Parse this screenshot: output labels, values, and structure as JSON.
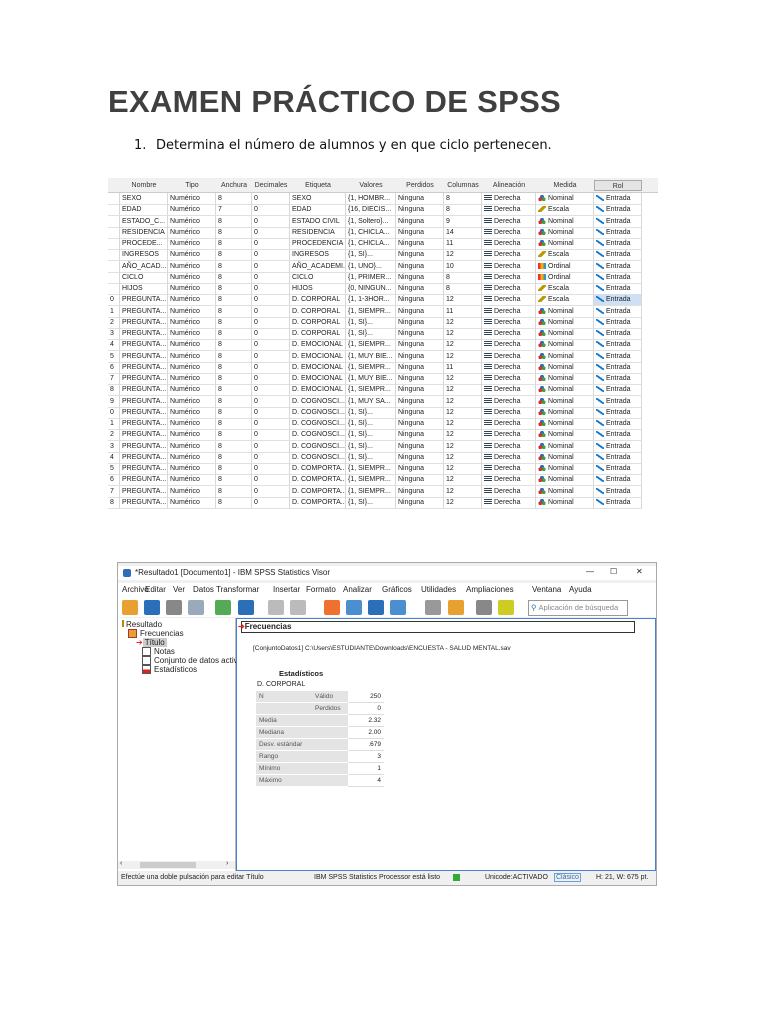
{
  "title": "EXAMEN PRÁCTICO DE SPSS",
  "question": {
    "number": "1.",
    "text": "Determina el número de alumnos y en que ciclo pertenecen."
  },
  "variable_view": {
    "headers": [
      "Nombre",
      "Tipo",
      "Anchura",
      "Decimales",
      "Etiqueta",
      "Valores",
      "Perdidos",
      "Columnas",
      "Alineación",
      "Medida",
      "Rol"
    ],
    "rows": [
      [
        "",
        "SEXO",
        "Numérico",
        "8",
        "0",
        "SEXO",
        "{1, HOMBR...",
        "Ninguna",
        "8",
        "Derecha",
        "Nominal",
        "Entrada"
      ],
      [
        "",
        "EDAD",
        "Numérico",
        "7",
        "0",
        "EDAD",
        "{16, DIECIS...",
        "Ninguna",
        "8",
        "Derecha",
        "Escala",
        "Entrada"
      ],
      [
        "",
        "ESTADO_C...",
        "Numérico",
        "8",
        "0",
        "ESTADO CIVIL",
        "{1, Soltero}...",
        "Ninguna",
        "9",
        "Derecha",
        "Nominal",
        "Entrada"
      ],
      [
        "",
        "RESIDENCIA",
        "Numérico",
        "8",
        "0",
        "RESIDENCIA",
        "{1, CHICLA...",
        "Ninguna",
        "14",
        "Derecha",
        "Nominal",
        "Entrada"
      ],
      [
        "",
        "PROCEDE...",
        "Numérico",
        "8",
        "0",
        "PROCEDENCIA",
        "{1, CHICLA...",
        "Ninguna",
        "11",
        "Derecha",
        "Nominal",
        "Entrada"
      ],
      [
        "",
        "INGRESOS",
        "Numérico",
        "8",
        "0",
        "INGRESOS",
        "{1, SI}...",
        "Ninguna",
        "12",
        "Derecha",
        "Escala",
        "Entrada"
      ],
      [
        "",
        "AÑO_ACAD...",
        "Numérico",
        "8",
        "0",
        "AÑO_ACADEMI...",
        "{1, UNO}...",
        "Ninguna",
        "10",
        "Derecha",
        "Ordinal",
        "Entrada"
      ],
      [
        "",
        "CICLO",
        "Numérico",
        "8",
        "0",
        "CICLO",
        "{1, PRIMER...",
        "Ninguna",
        "8",
        "Derecha",
        "Ordinal",
        "Entrada"
      ],
      [
        "",
        "HIJOS",
        "Numérico",
        "8",
        "0",
        "HIJOS",
        "{0, NINGUN...",
        "Ninguna",
        "8",
        "Derecha",
        "Escala",
        "Entrada"
      ],
      [
        "0",
        "PREGUNTA...",
        "Numérico",
        "8",
        "0",
        "D. CORPORAL",
        "{1, 1-3HOR...",
        "Ninguna",
        "12",
        "Derecha",
        "Escala",
        "Entrada"
      ],
      [
        "1",
        "PREGUNTA...",
        "Numérico",
        "8",
        "0",
        "D. CORPORAL",
        "{1, SIEMPR...",
        "Ninguna",
        "11",
        "Derecha",
        "Nominal",
        "Entrada"
      ],
      [
        "2",
        "PREGUNTA...",
        "Numérico",
        "8",
        "0",
        "D. CORPORAL",
        "{1, SI}...",
        "Ninguna",
        "12",
        "Derecha",
        "Nominal",
        "Entrada"
      ],
      [
        "3",
        "PREGUNTA...",
        "Numérico",
        "8",
        "0",
        "D. CORPORAL",
        "{1, SI}...",
        "Ninguna",
        "12",
        "Derecha",
        "Nominal",
        "Entrada"
      ],
      [
        "4",
        "PREGUNTA...",
        "Numérico",
        "8",
        "0",
        "D. EMOCIONAL",
        "{1, SIEMPR...",
        "Ninguna",
        "12",
        "Derecha",
        "Nominal",
        "Entrada"
      ],
      [
        "5",
        "PREGUNTA...",
        "Numérico",
        "8",
        "0",
        "D. EMOCIONAL",
        "{1, MUY BIE...",
        "Ninguna",
        "12",
        "Derecha",
        "Nominal",
        "Entrada"
      ],
      [
        "6",
        "PREGUNTA...",
        "Numérico",
        "8",
        "0",
        "D. EMOCIONAL",
        "{1, SIEMPR...",
        "Ninguna",
        "11",
        "Derecha",
        "Nominal",
        "Entrada"
      ],
      [
        "7",
        "PREGUNTA...",
        "Numérico",
        "8",
        "0",
        "D. EMOCIONAL",
        "{1, MUY BIE...",
        "Ninguna",
        "12",
        "Derecha",
        "Nominal",
        "Entrada"
      ],
      [
        "8",
        "PREGUNTA...",
        "Numérico",
        "8",
        "0",
        "D. EMOCIONAL",
        "{1, SIEMPR...",
        "Ninguna",
        "12",
        "Derecha",
        "Nominal",
        "Entrada"
      ],
      [
        "9",
        "PREGUNTA...",
        "Numérico",
        "8",
        "0",
        "D. COGNOSCI...",
        "{1, MUY SA...",
        "Ninguna",
        "12",
        "Derecha",
        "Nominal",
        "Entrada"
      ],
      [
        "0",
        "PREGUNTA...",
        "Numérico",
        "8",
        "0",
        "D. COGNOSCI...",
        "{1, SI}...",
        "Ninguna",
        "12",
        "Derecha",
        "Nominal",
        "Entrada"
      ],
      [
        "1",
        "PREGUNTA...",
        "Numérico",
        "8",
        "0",
        "D. COGNOSCI...",
        "{1, SI}...",
        "Ninguna",
        "12",
        "Derecha",
        "Nominal",
        "Entrada"
      ],
      [
        "2",
        "PREGUNTA...",
        "Numérico",
        "8",
        "0",
        "D. COGNOSCI...",
        "{1, SI}...",
        "Ninguna",
        "12",
        "Derecha",
        "Nominal",
        "Entrada"
      ],
      [
        "3",
        "PREGUNTA...",
        "Numérico",
        "8",
        "0",
        "D. COGNOSCI...",
        "{1, SI}...",
        "Ninguna",
        "12",
        "Derecha",
        "Nominal",
        "Entrada"
      ],
      [
        "4",
        "PREGUNTA...",
        "Numérico",
        "8",
        "0",
        "D. COGNOSCI...",
        "{1, SI}...",
        "Ninguna",
        "12",
        "Derecha",
        "Nominal",
        "Entrada"
      ],
      [
        "5",
        "PREGUNTA...",
        "Numérico",
        "8",
        "0",
        "D. COMPORTA...",
        "{1, SIEMPR...",
        "Ninguna",
        "12",
        "Derecha",
        "Nominal",
        "Entrada"
      ],
      [
        "6",
        "PREGUNTA...",
        "Numérico",
        "8",
        "0",
        "D. COMPORTA...",
        "{1, SIEMPR...",
        "Ninguna",
        "12",
        "Derecha",
        "Nominal",
        "Entrada"
      ],
      [
        "7",
        "PREGUNTA...",
        "Numérico",
        "8",
        "0",
        "D. COMPORTA...",
        "{1, SIEMPR...",
        "Ninguna",
        "12",
        "Derecha",
        "Nominal",
        "Entrada"
      ],
      [
        "8",
        "PREGUNTA...",
        "Numérico",
        "8",
        "0",
        "D. COMPORTA...",
        "{1, SI}...",
        "Ninguna",
        "12",
        "Derecha",
        "Nominal",
        "Entrada"
      ]
    ]
  },
  "viewer": {
    "window_title": "*Resultado1 [Documento1] - IBM SPSS Statistics Visor",
    "window_controls": {
      "minimize": "—",
      "maximize": "☐",
      "close": "✕"
    },
    "menu": [
      "Archivo",
      "Editar",
      "Ver",
      "Datos",
      "Transformar",
      "Insertar",
      "Formato",
      "Analizar",
      "Gráficos",
      "Utilidades",
      "Ampliaciones",
      "Ventana",
      "Ayuda"
    ],
    "search_placeholder": "Aplicación de búsqueda",
    "tree": [
      "Resultado",
      "Frecuencias",
      "Título",
      "Notas",
      "Conjunto de datos activo",
      "Estadísticos"
    ],
    "output_title": "Frecuencias",
    "dataset_path": "[ConjuntoDatos1] C:\\Users\\ESTUDIANTE\\Downloads\\ENCUESTA - SALUD MENTAL.sav",
    "stats_title": "Estadísticos",
    "stats_variable": "D. CORPORAL",
    "stats": [
      {
        "group": "N",
        "label": "Válido",
        "value": "250"
      },
      {
        "group": "",
        "label": "Perdidos",
        "value": "0"
      },
      {
        "group": "Media",
        "label": "",
        "value": "2.32"
      },
      {
        "group": "Mediana",
        "label": "",
        "value": "2.00"
      },
      {
        "group": "Desv. estándar",
        "label": "",
        "value": ".679"
      },
      {
        "group": "Rango",
        "label": "",
        "value": "3"
      },
      {
        "group": "Mínimo",
        "label": "",
        "value": "1"
      },
      {
        "group": "Máximo",
        "label": "",
        "value": "4"
      }
    ],
    "status": {
      "left": "Efectúe una doble pulsación para editar Título",
      "processor": "IBM SPSS Statistics Processor está listo",
      "unicode": "Unicode:ACTIVADO",
      "mode": "Clásico",
      "size": "H: 21, W: 675 pt."
    }
  }
}
